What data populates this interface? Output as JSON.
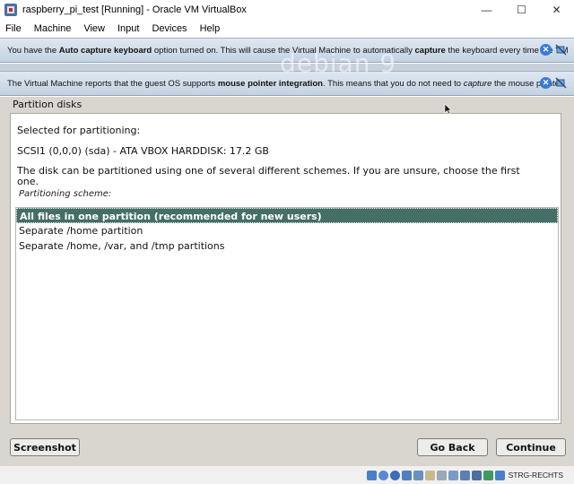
{
  "window": {
    "title": "raspberry_pi_test [Running] - Oracle VM VirtualBox",
    "controls": {
      "minimize": "—",
      "maximize": "☐",
      "close": "✕"
    }
  },
  "menubar": {
    "items": [
      "File",
      "Machine",
      "View",
      "Input",
      "Devices",
      "Help"
    ]
  },
  "notifications": {
    "keyboard": {
      "t1": "You have the ",
      "b1": "Auto capture keyboard",
      "t2": " option turned on. This will cause the Virtual Machine to automatically ",
      "b2": "capture",
      "t3": " the keyboard every time the VM"
    },
    "mouse": {
      "t1": "The Virtual Machine reports that the guest OS supports ",
      "b1": "mouse pointer integration",
      "t2": ". This means that you do not need to ",
      "i1": "capture",
      "t3": " the mouse pointer"
    }
  },
  "watermark": "debian 9",
  "installer": {
    "section_title": "Partition disks",
    "selected_label": "Selected for partitioning:",
    "disk": "SCSI1 (0,0,0) (sda) - ATA VBOX HARDDISK: 17.2 GB",
    "description_line1": "The disk can be partitioned using one of several different schemes. If you are unsure, choose the first",
    "description_line2": "one.",
    "scheme_label": "Partitioning scheme:",
    "options": [
      "All files in one partition (recommended for new users)",
      "Separate /home partition",
      "Separate /home, /var, and /tmp partitions"
    ],
    "selected_index": 0,
    "buttons": {
      "screenshot": "Screenshot",
      "back": "Go Back",
      "continue": "Continue"
    }
  },
  "statusbar": {
    "host_key": "STRG-RECHTS"
  },
  "colors": {
    "selected_row": "#456e66",
    "installer_bg": "#d9d6d0",
    "notification_bg": "#c3d2e2"
  }
}
